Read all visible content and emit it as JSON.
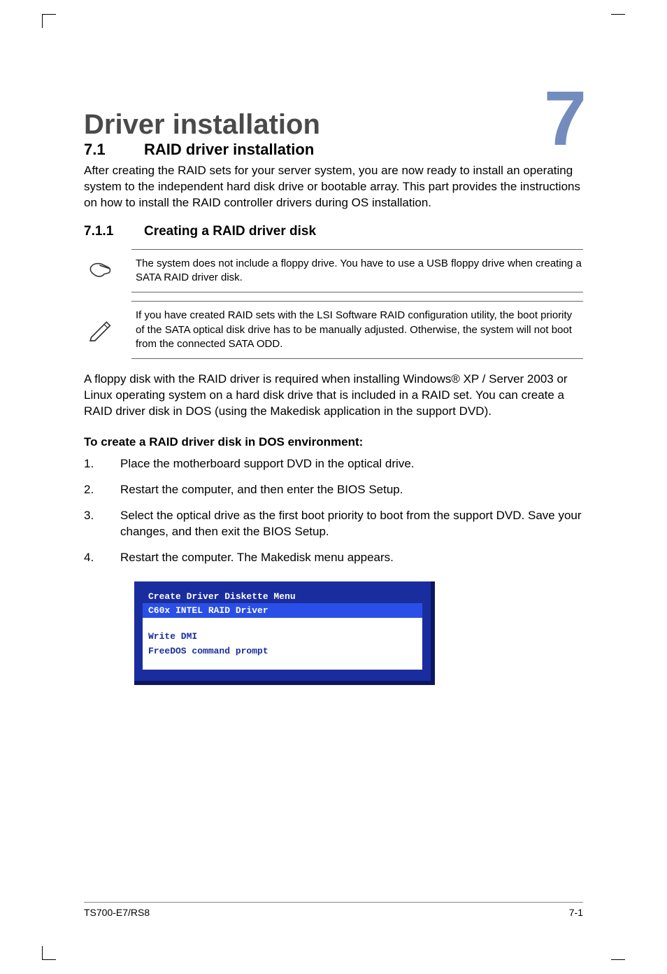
{
  "chapter": {
    "title": "Driver installation",
    "number": "7"
  },
  "section": {
    "number": "7.1",
    "title": "RAID driver installation",
    "intro": "After creating the RAID sets for your server system, you are now ready to install an operating system to the independent hard disk drive or bootable array. This part provides the instructions on how to install the RAID controller drivers during OS installation."
  },
  "subsection": {
    "number": "7.1.1",
    "title": "Creating a RAID driver disk"
  },
  "notes": {
    "hand": "The system does not include a floppy drive. You have to use a USB floppy drive when creating a SATA RAID driver disk.",
    "pencil": "If you have created RAID sets with the LSI Software RAID configuration utility, the boot priority of the SATA optical disk drive has to be manually adjusted. Otherwise, the system will not boot from the connected SATA ODD."
  },
  "paragraph": "A floppy disk with the RAID driver is required when installing Windows® XP / Server 2003 or Linux operating system on a hard disk drive that is included in a RAID set. You can create a RAID driver disk in DOS (using the Makedisk application in the support DVD).",
  "procedure": {
    "heading": "To create a RAID driver disk in DOS environment:",
    "steps": [
      "Place the motherboard support DVD in the optical drive.",
      "Restart the computer, and then enter the BIOS Setup.",
      "Select the optical drive as the first boot priority to boot from the support DVD. Save your changes, and then exit the BIOS Setup.",
      "Restart the computer. The Makedisk menu appears."
    ]
  },
  "menu": {
    "title": "Create Driver Diskette Menu",
    "selected": "C60x INTEL RAID Driver",
    "items": [
      "Write DMI",
      "FreeDOS command prompt"
    ]
  },
  "footer": {
    "left": "TS700-E7/RS8",
    "right": "7-1"
  }
}
